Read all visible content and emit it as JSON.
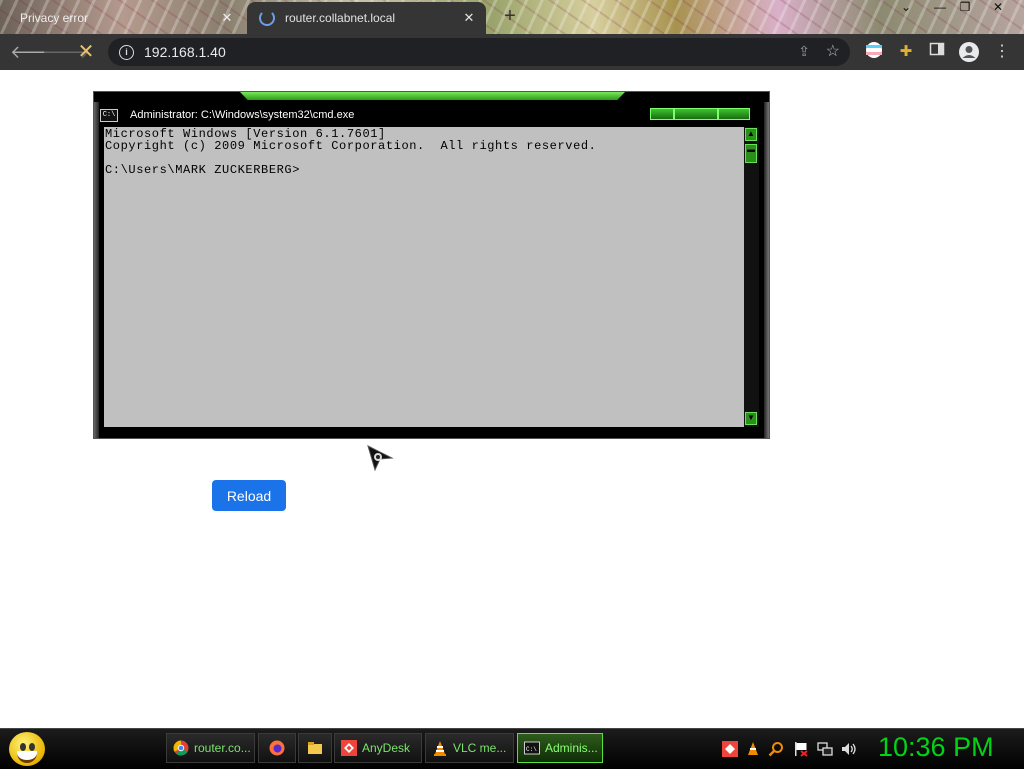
{
  "browser": {
    "tabs": [
      {
        "title": "Privacy error",
        "active": false
      },
      {
        "title": "router.collabnet.local",
        "active": true
      }
    ],
    "new_tab_symbol": "+",
    "tab_close_symbol": "✕",
    "window_controls": {
      "minimize": "⌄",
      "restore": "❐",
      "close": "✕"
    },
    "url": "192.168.1.40",
    "nav_icons": [
      "back-arrow-icon",
      "forward-arrow-icon",
      "stop-loading-icon"
    ],
    "toolbar_icons": [
      "share-icon",
      "bookmark-star-icon",
      "profile-flag-icon",
      "extensions-puzzle-icon",
      "side-panel-icon",
      "account-avatar-icon",
      "more-menu-icon"
    ]
  },
  "cmd_window": {
    "title": "Administrator: C:\\Windows\\system32\\cmd.exe",
    "icon_text": "C:\\",
    "console_text": "Microsoft Windows [Version 6.1.7601]\nCopyright (c) 2009 Microsoft Corporation.  All rights reserved.\n\nC:\\Users\\MARK ZUCKERBERG>"
  },
  "page": {
    "reload_label": "Reload"
  },
  "taskbar": {
    "tasks": [
      {
        "label": "router.co...",
        "icon": "chrome-icon"
      },
      {
        "label": "",
        "icon": "firefox-icon"
      },
      {
        "label": "",
        "icon": "folder-icon"
      },
      {
        "label": "AnyDesk",
        "icon": "anydesk-icon"
      },
      {
        "label": "VLC me...",
        "icon": "vlc-cone-icon"
      },
      {
        "label": "Adminis...",
        "icon": "cmd-icon",
        "active": true
      }
    ],
    "tray_icons": [
      "anydesk-tray-icon",
      "vlc-tray-icon",
      "search-tray-icon",
      "action-center-flag-icon",
      "network-icon",
      "volume-icon"
    ],
    "clock": "10:36 PM"
  },
  "colors": {
    "accent_blue": "#1a73e8",
    "theme_green": "#00d414",
    "console_bg": "#c0c0c0"
  }
}
